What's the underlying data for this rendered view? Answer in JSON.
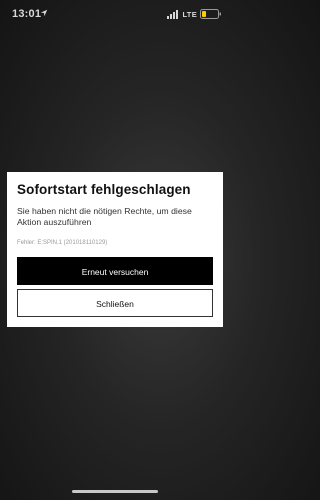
{
  "status_bar": {
    "time": "13:01",
    "carrier": "LTE",
    "icons": [
      "location-arrow-icon",
      "cellular-signal-icon",
      "battery-icon"
    ],
    "battery_color": "#ffcc00"
  },
  "dialog": {
    "title": "Sofortstart fehlgeschlagen",
    "message": "Sie haben nicht die nötigen Rechte, um diese Aktion auszuführen",
    "error_code": "Fehler: E:SPIN.1 (201018110129)",
    "primary_button": "Erneut versuchen",
    "secondary_button": "Schließen"
  },
  "colors": {
    "dialog_background": "#ffffff",
    "primary_button": "#000000",
    "overlay": "#1a1a1a"
  }
}
